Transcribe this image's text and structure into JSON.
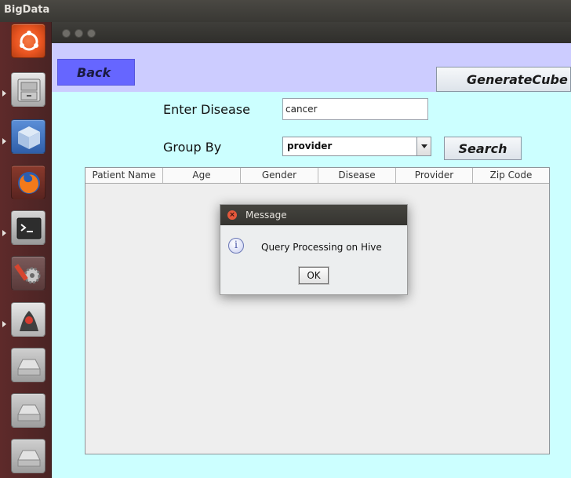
{
  "app": {
    "title": "BigData"
  },
  "launcher": {
    "items": [
      {
        "icon": "ubuntu-dash-icon",
        "color": "#e95420"
      },
      {
        "icon": "file-cabinet-icon",
        "color": "#bfbfbf"
      },
      {
        "icon": "cube-app-icon",
        "color": "#4a7fd0"
      },
      {
        "icon": "firefox-icon",
        "color": "#e66000"
      },
      {
        "icon": "terminal-icon",
        "color": "#3a3a3a"
      },
      {
        "icon": "system-settings-icon",
        "color": "#8a8a8a"
      },
      {
        "icon": "java-app-icon",
        "color": "#d0d0d0"
      },
      {
        "icon": "drive-icon",
        "color": "#bdbdbd"
      },
      {
        "icon": "drive-icon",
        "color": "#bdbdbd"
      },
      {
        "icon": "drive-icon",
        "color": "#bdbdbd"
      }
    ]
  },
  "toolbar": {
    "back_label": "Back",
    "generate_cube_label": "GenerateCube"
  },
  "form": {
    "disease_label": "Enter Disease",
    "disease_value": "cancer",
    "group_by_label": "Group By",
    "group_by_value": "provider",
    "search_label": "Search"
  },
  "table": {
    "columns": [
      "Patient Name",
      "Age",
      "Gender",
      "Disease",
      "Provider",
      "Zip Code"
    ],
    "rows": []
  },
  "dialog": {
    "title": "Message",
    "message": "Query Processing on Hive",
    "ok_label": "OK"
  },
  "colors": {
    "window_bg": "#ccffff",
    "header_band": "#ccccff",
    "back_button": "#6666ff"
  }
}
